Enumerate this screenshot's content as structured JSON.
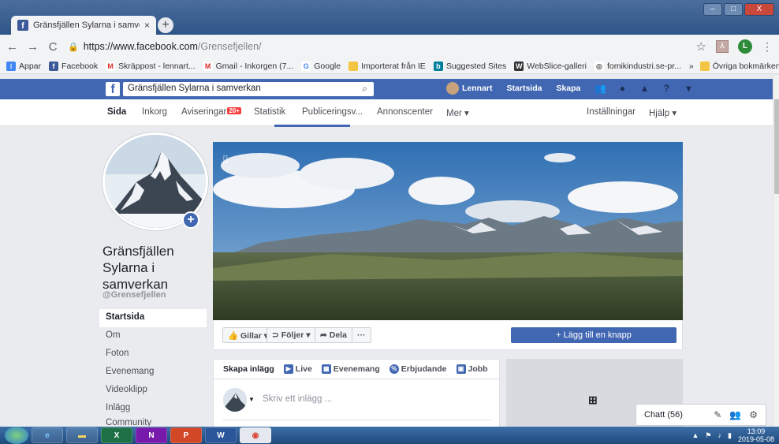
{
  "browser": {
    "tab_title": "Gränsfjällen Sylarna i samverkan",
    "tab_close": "×",
    "new_tab": "+",
    "url_host": "https://www.facebook.com",
    "url_path": "/Grensefjellen/",
    "profile_initial": "L",
    "window_buttons": [
      "–",
      "□",
      "X"
    ]
  },
  "bookmarks": {
    "items": [
      {
        "label": "Appar",
        "icon": "apps-grid-icon",
        "color": "#4285f4",
        "glyph": "⁝"
      },
      {
        "label": "Facebook",
        "icon": "facebook-icon",
        "color": "#3b5998",
        "glyph": "f"
      },
      {
        "label": "Skräppost - lennart...",
        "icon": "gmail-icon",
        "color": "#d93025",
        "glyph": "M"
      },
      {
        "label": "Gmail - Inkorgen (7...",
        "icon": "gmail-icon",
        "color": "#d93025",
        "glyph": "M"
      },
      {
        "label": "Google",
        "icon": "google-icon",
        "color": "#4285f4",
        "glyph": "G"
      },
      {
        "label": "Importerat från IE",
        "icon": "folder-icon",
        "color": "#f4c542",
        "glyph": ""
      },
      {
        "label": "Suggested Sites",
        "icon": "bing-icon",
        "color": "#00809d",
        "glyph": "b"
      },
      {
        "label": "WebSlice-galleri",
        "icon": "webslice-icon",
        "color": "#333333",
        "glyph": "W"
      },
      {
        "label": "fomikindustri.se-pr...",
        "icon": "globe-icon",
        "color": "#555555",
        "glyph": "◎"
      }
    ],
    "overflow": "»",
    "other": "Övriga bokmärken"
  },
  "fb": {
    "search_value": "Gränsfjällen Sylarna i samverkan",
    "user_name": "Lennart",
    "home": "Startsida",
    "create": "Skapa"
  },
  "pagenav": {
    "items": [
      "Sida",
      "Inkorg",
      "Aviseringar",
      "Statistik",
      "Publiceringsv...",
      "Annonscenter",
      "Mer ▾"
    ],
    "notif_badge": "20+",
    "settings": "Inställningar",
    "help": "Hjälp ▾"
  },
  "page": {
    "name": "Gränsfjällen Sylarna i samverkan",
    "handle": "@Grensefjellen",
    "nav": [
      "Startsida",
      "Om",
      "Foton",
      "Evenemang",
      "Videoklipp",
      "Inlägg",
      "Community"
    ]
  },
  "actions": {
    "like": "Gillar ▾",
    "follow": "Följer ▾",
    "share": "Dela",
    "more": "···",
    "add_button": "+ Lägg till en knapp"
  },
  "composer": {
    "create_post": "Skapa inlägg",
    "live": "Live",
    "event": "Evenemang",
    "offer": "Erbjudande",
    "job": "Jobb",
    "placeholder": "Skriv ett inlägg ..."
  },
  "chat": {
    "label": "Chatt (56)"
  },
  "taskbar": {
    "time": "13:09",
    "date": "2019-05-08"
  },
  "colors": {
    "fb_blue": "#4267b2",
    "badge_red": "#fa3e3e"
  }
}
